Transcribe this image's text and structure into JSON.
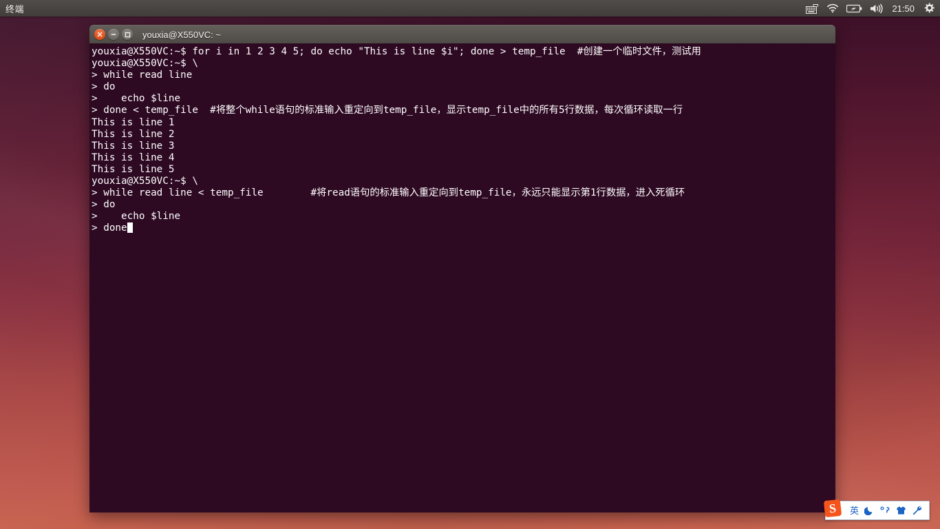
{
  "panel": {
    "app_name": "终端",
    "clock": "21:50",
    "indicators": [
      {
        "name": "keyboard-indicator-icon",
        "label": "keyboard"
      },
      {
        "name": "wifi-indicator-icon",
        "label": "wifi"
      },
      {
        "name": "battery-indicator-icon",
        "label": "battery"
      },
      {
        "name": "volume-indicator-icon",
        "label": "volume"
      },
      {
        "name": "system-settings-gear-icon",
        "label": "gear"
      }
    ]
  },
  "window": {
    "title": "youxia@X550VC: ~",
    "controls": {
      "close_label": "×",
      "minimize_label": "−",
      "maximize_label": "□"
    }
  },
  "terminal": {
    "background_color": "#2d0922",
    "foreground_color": "#ffffff",
    "lines": [
      "youxia@X550VC:~$ for i in 1 2 3 4 5; do echo \"This is line $i\"; done > temp_file  #创建一个临时文件，测试用",
      "youxia@X550VC:~$ \\",
      "> while read line",
      "> do",
      ">    echo $line",
      "> done < temp_file  #将整个while语句的标准输入重定向到temp_file，显示temp_file中的所有5行数据，每次循环读取一行",
      "This is line 1",
      "This is line 2",
      "This is line 3",
      "This is line 4",
      "This is line 5",
      "youxia@X550VC:~$ \\",
      "> while read line < temp_file        #将read语句的标准输入重定向到temp_file，永远只能显示第1行数据，进入死循环",
      "> do",
      ">    echo $line",
      "> done"
    ],
    "cursor_after_line_index": 15
  },
  "ime": {
    "logo_letter": "S",
    "items": [
      {
        "name": "ime-language-mode",
        "label": "英"
      },
      {
        "name": "ime-moon-icon",
        "label": "moon"
      },
      {
        "name": "ime-punctuation-icon",
        "label": "，"
      },
      {
        "name": "ime-skin-icon",
        "label": "shirt"
      },
      {
        "name": "ime-toolbox-icon",
        "label": "wrench"
      }
    ]
  }
}
